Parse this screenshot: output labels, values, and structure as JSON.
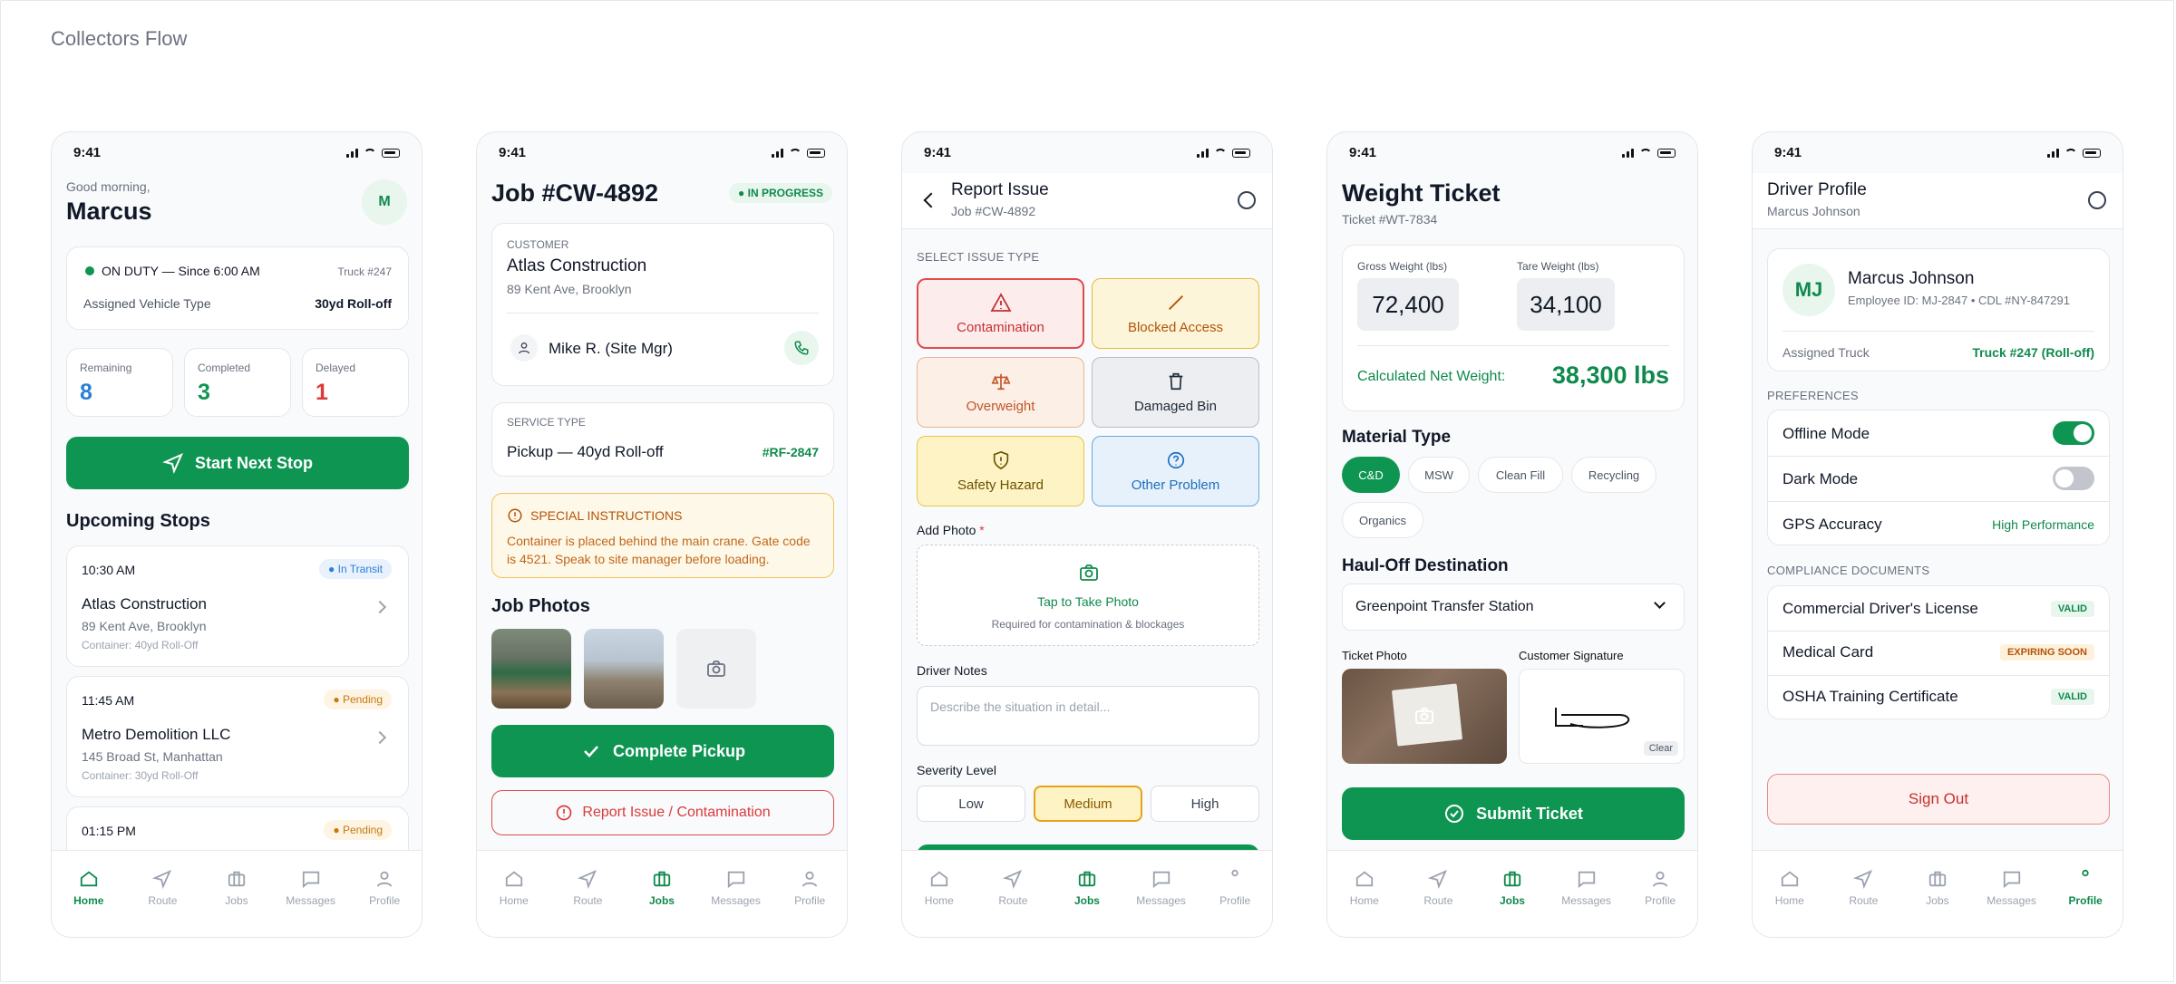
{
  "page": {
    "title": "Collectors Flow"
  },
  "status": {
    "time": "9:41"
  },
  "tabs": [
    "Home",
    "Route",
    "Jobs",
    "Messages",
    "Profile"
  ],
  "home": {
    "greeting": "Good morning,",
    "name": "Marcus",
    "avatar": "M",
    "duty": "ON DUTY — Since 6:00 AM",
    "truck": "Truck #247",
    "vehicle_label": "Assigned Vehicle Type",
    "vehicle": "30yd Roll-off",
    "stats": [
      {
        "label": "Remaining",
        "value": "8",
        "color": "#2b7fd6"
      },
      {
        "label": "Completed",
        "value": "3",
        "color": "#0f9552"
      },
      {
        "label": "Delayed",
        "value": "1",
        "color": "#dc3a3a"
      }
    ],
    "start_btn": "Start Next Stop",
    "upcoming": "Upcoming Stops",
    "stops": [
      {
        "time": "10:30 AM",
        "status": "In Transit",
        "name": "Atlas Construction",
        "addr": "89 Kent Ave, Brooklyn",
        "container": "Container: 40yd Roll-Off"
      },
      {
        "time": "11:45 AM",
        "status": "Pending",
        "name": "Metro Demolition LLC",
        "addr": "145 Broad St, Manhattan",
        "container": "Container: 30yd Roll-Off"
      },
      {
        "time": "01:15 PM",
        "status": "Pending"
      }
    ]
  },
  "job": {
    "title": "Job #CW-4892",
    "status": "IN PROGRESS",
    "customer_label": "CUSTOMER",
    "customer": "Atlas Construction",
    "address": "89 Kent Ave, Brooklyn",
    "contact": "Mike R. (Site Mgr)",
    "service_label": "SERVICE TYPE",
    "service": "Pickup — 40yd Roll-off",
    "ref": "#RF-2847",
    "instructions_title": "SPECIAL INSTRUCTIONS",
    "instructions": "Container is placed behind the main crane. Gate code is 4521. Speak to site manager before loading.",
    "photos_title": "Job Photos",
    "complete_btn": "Complete Pickup",
    "report_btn": "Report Issue / Contamination"
  },
  "issue": {
    "title": "Report Issue",
    "sub": "Job #CW-4892",
    "select_label": "SELECT ISSUE TYPE",
    "types": [
      "Contamination",
      "Blocked Access",
      "Overweight",
      "Damaged Bin",
      "Safety Hazard",
      "Other Problem"
    ],
    "photo_label": "Add Photo",
    "photo_required": "*",
    "tap_photo": "Tap to Take Photo",
    "photo_hint": "Required for contamination & blockages",
    "notes_label": "Driver Notes",
    "notes_placeholder": "Describe the situation in detail...",
    "severity_label": "Severity Level",
    "severity": [
      "Low",
      "Medium",
      "High"
    ]
  },
  "ticket": {
    "title": "Weight Ticket",
    "sub": "Ticket #WT-7834",
    "gross_label": "Gross Weight (lbs)",
    "gross": "72,400",
    "tare_label": "Tare Weight (lbs)",
    "tare": "34,100",
    "net_label": "Calculated Net Weight:",
    "net": "38,300 lbs",
    "material_title": "Material Type",
    "materials": [
      "C&D",
      "MSW",
      "Clean Fill",
      "Recycling",
      "Organics"
    ],
    "haul_title": "Haul-Off Destination",
    "destination": "Greenpoint Transfer Station",
    "photo_label": "Ticket Photo",
    "sig_label": "Customer Signature",
    "clear": "Clear",
    "submit": "Submit Ticket"
  },
  "profile": {
    "title": "Driver Profile",
    "sub": "Marcus Johnson",
    "initials": "MJ",
    "name": "Marcus Johnson",
    "ids": "Employee ID: MJ-2847 • CDL #NY-847291",
    "truck_label": "Assigned Truck",
    "truck": "Truck #247 (Roll-off)",
    "pref_label": "PREFERENCES",
    "offline": "Offline Mode",
    "dark": "Dark Mode",
    "gps": "GPS Accuracy",
    "gps_value": "High Performance",
    "docs_label": "COMPLIANCE DOCUMENTS",
    "docs": [
      {
        "name": "Commercial Driver's License",
        "status": "VALID"
      },
      {
        "name": "Medical Card",
        "status": "EXPIRING SOON"
      },
      {
        "name": "OSHA Training Certificate",
        "status": "VALID"
      }
    ],
    "signout": "Sign Out"
  }
}
